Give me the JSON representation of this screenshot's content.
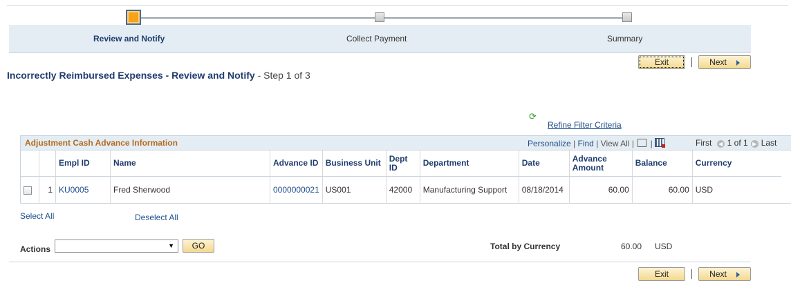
{
  "steps": [
    {
      "label": "Review and Notify",
      "state": "active"
    },
    {
      "label": "Collect Payment",
      "state": "inactive"
    },
    {
      "label": "Summary",
      "state": "inactive"
    }
  ],
  "buttons": {
    "exit": "Exit",
    "next": "Next",
    "go": "GO"
  },
  "page": {
    "title": "Incorrectly Reimbursed Expenses - Review and Notify",
    "step_info": "- Step 1 of 3"
  },
  "refine_filter": "Refine Filter Criteria",
  "grid": {
    "title": "Adjustment Cash Advance Information",
    "nav": {
      "personalize": "Personalize",
      "find": "Find",
      "view_all": "View All",
      "sep": "|"
    },
    "pager": {
      "first": "First",
      "range": "1 of 1",
      "last": "Last"
    },
    "columns": [
      "",
      "",
      "Empl ID",
      "Name",
      "Advance ID",
      "Business Unit",
      "Dept ID",
      "Department",
      "Date",
      "Advance Amount",
      "Balance",
      "Currency"
    ],
    "rows": [
      {
        "row_num": "1",
        "empl_id": "KU0005",
        "name": "Fred Sherwood",
        "advance_id": "0000000021",
        "business_unit": "US001",
        "dept_id": "42000",
        "department": "Manufacturing Support",
        "date": "08/18/2014",
        "advance_amount": "60.00",
        "balance": "60.00",
        "currency": "USD"
      }
    ]
  },
  "select_all": "Select All",
  "deselect_all": "Deselect All",
  "actions": {
    "label": "Actions",
    "value": ""
  },
  "total": {
    "label": "Total by Currency",
    "amount": "60.00",
    "currency": "USD"
  },
  "colors": {
    "accent": "#f7a21b",
    "title": "#1f3c6e",
    "grid_title": "#b36b22",
    "link": "#1f4e8c"
  }
}
